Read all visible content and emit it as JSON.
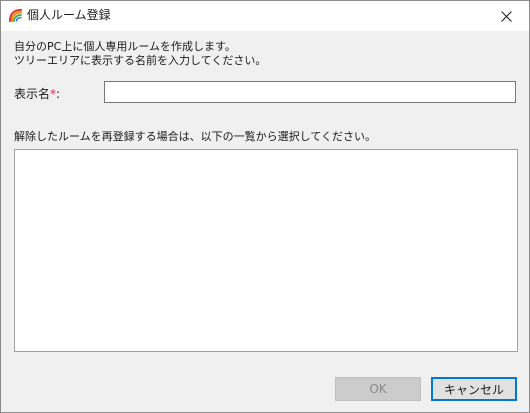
{
  "window": {
    "title": "個人ルーム登録",
    "close_glyph": "✕"
  },
  "instructions": {
    "line1": "自分のPC上に個人専用ルームを作成します。",
    "line2": "ツリーエリアに表示する名前を入力してください。"
  },
  "display_name": {
    "label": "表示名",
    "required_mark": "*",
    "colon": ":",
    "value": ""
  },
  "room_list": {
    "instruction": "解除したルームを再登録する場合は、以下の一覧から選択してください。",
    "items": []
  },
  "buttons": {
    "ok_label": "OK",
    "cancel_label": "キャンセル"
  },
  "colors": {
    "required": "#e0245e",
    "focus_border": "#0078d7"
  }
}
